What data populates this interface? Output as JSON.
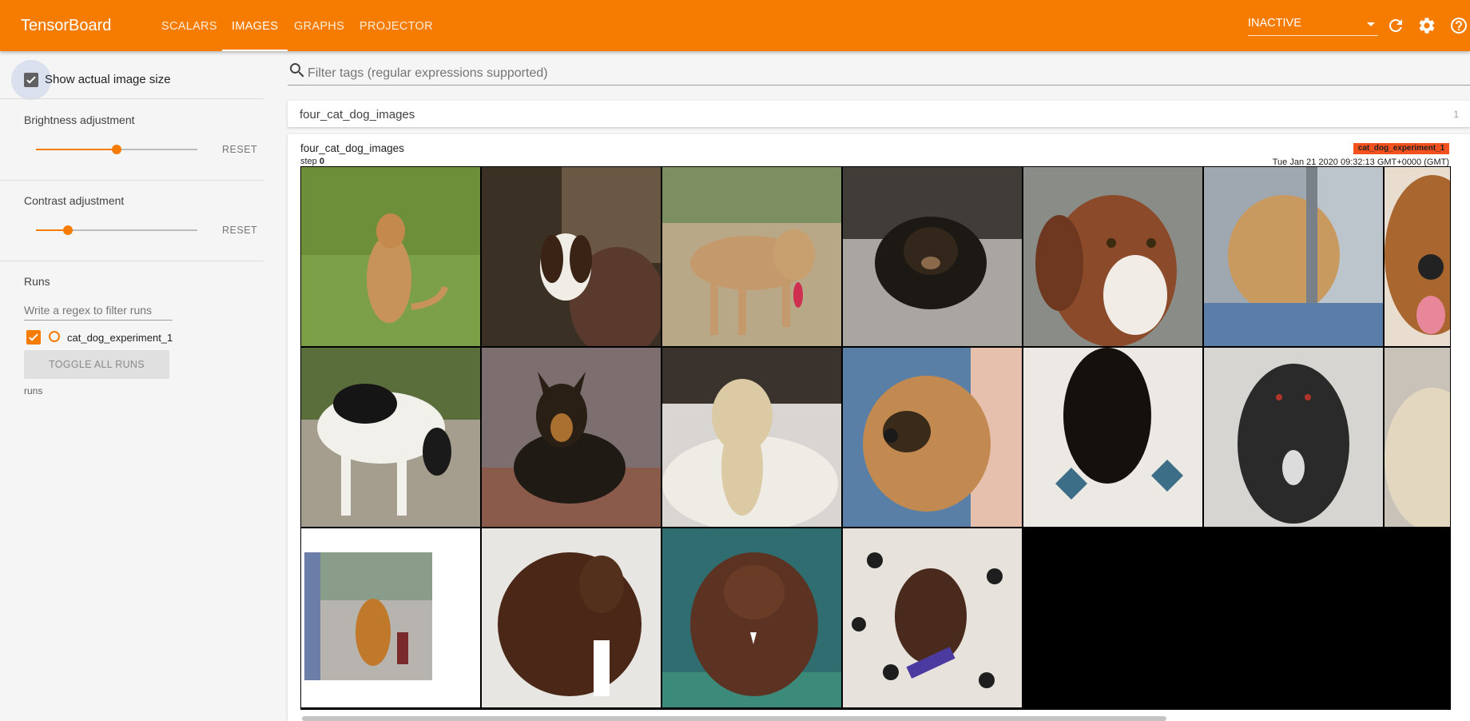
{
  "header": {
    "brand": "TensorBoard",
    "tabs": [
      {
        "label": "SCALARS",
        "active": false
      },
      {
        "label": "IMAGES",
        "active": true
      },
      {
        "label": "GRAPHS",
        "active": false
      },
      {
        "label": "PROJECTOR",
        "active": false
      }
    ],
    "status_select": "INACTIVE",
    "icons": [
      "dropdown-caret-icon",
      "refresh-icon",
      "settings-icon",
      "help-icon"
    ]
  },
  "sidebar": {
    "show_actual_size": {
      "label": "Show actual image size",
      "checked": true
    },
    "brightness": {
      "label": "Brightness adjustment",
      "reset": "RESET",
      "level": 0.5
    },
    "contrast": {
      "label": "Contrast adjustment",
      "reset": "RESET",
      "level": 0.2
    },
    "runs": {
      "title": "Runs",
      "filter_placeholder": "Write a regex to filter runs",
      "items": [
        {
          "name": "cat_dog_experiment_1",
          "checked": true
        }
      ],
      "toggle_all": "TOGGLE ALL RUNS",
      "footer": "runs"
    }
  },
  "main": {
    "tag_filter_placeholder": "Filter tags (regular expressions supported)",
    "category": {
      "name": "four_cat_dog_images",
      "count": "1"
    },
    "card": {
      "tag": "four_cat_dog_images",
      "step_label": "step",
      "step_value": "0",
      "run_badge": "cat_dog_experiment_1",
      "timestamp": "Tue Jan 21 2020 09:32:13 GMT+0000 (GMT)"
    },
    "images": [
      {
        "subject": "tan dog sitting on grass"
      },
      {
        "subject": "beagle puppy held by person"
      },
      {
        "subject": "tan dog with collar being petted"
      },
      {
        "subject": "black and tan puppy lying on gravel"
      },
      {
        "subject": "brown and white spaniel"
      },
      {
        "subject": "tan dog near fence"
      },
      {
        "subject": "brown dog with tongue out"
      },
      {
        "subject": "black and white dog sniffing ground"
      },
      {
        "subject": "german shepherd lying on bricks"
      },
      {
        "subject": "yellow dog on blanket in cage"
      },
      {
        "subject": "tan puppy held by person"
      },
      {
        "subject": "black dog on tiled floor"
      },
      {
        "subject": "black fluffy dog"
      },
      {
        "subject": "pale dog in kennel"
      },
      {
        "subject": "golden retriever sitting on patio"
      },
      {
        "subject": "chocolate labrador on pavement"
      },
      {
        "subject": "brown pitbull sitting"
      },
      {
        "subject": "brown puppy on paw-print blanket"
      }
    ],
    "colors": {
      "accent": "#f57c00",
      "run_badge": "#f4511e"
    }
  }
}
